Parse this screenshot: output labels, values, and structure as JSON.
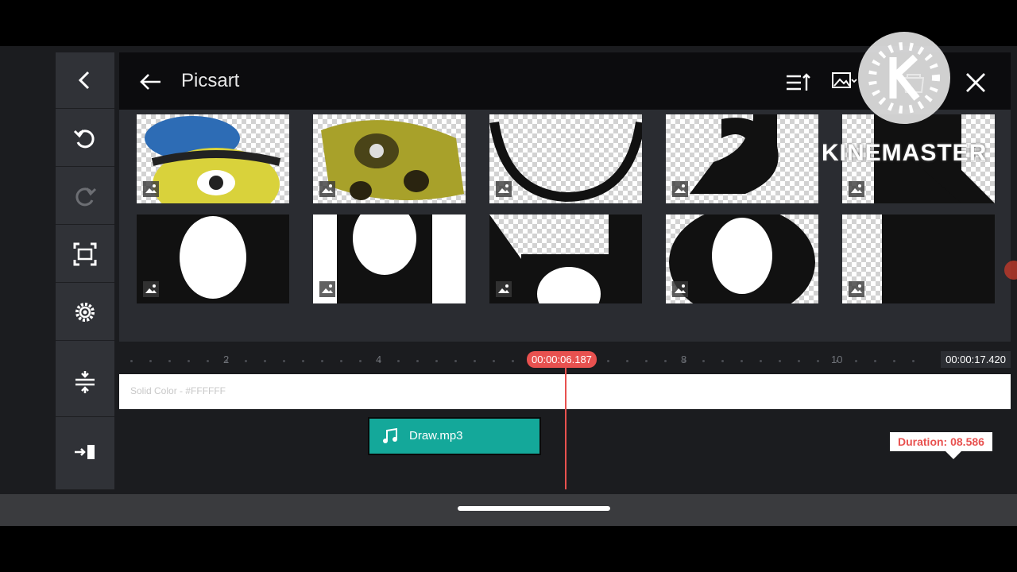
{
  "app": {
    "title": "Picsart"
  },
  "header": {
    "title": "Picsart"
  },
  "timeline": {
    "ruler_labels": [
      "2",
      "4",
      "8",
      "10"
    ],
    "playhead_time": "00:00:06.187",
    "end_time": "00:00:17.420",
    "solid_track_label": "Solid Color - #FFFFFF",
    "audio_clip_label": "Draw.mp3",
    "duration_tooltip": "Duration: 08.586"
  },
  "watermark": {
    "text": "KINEMASTER"
  },
  "colors": {
    "accent": "#e8514f",
    "audio_clip": "#14a89a",
    "track": "#ffffff"
  },
  "icons": {
    "sidebar": [
      "back-icon",
      "undo-icon",
      "redo-icon",
      "screen-capture-icon",
      "settings-gear-icon",
      "align-timeline-icon",
      "export-icon"
    ],
    "header": [
      "back-arrow-icon",
      "sort-icon",
      "image-filter-icon",
      "store-icon",
      "close-icon"
    ]
  }
}
